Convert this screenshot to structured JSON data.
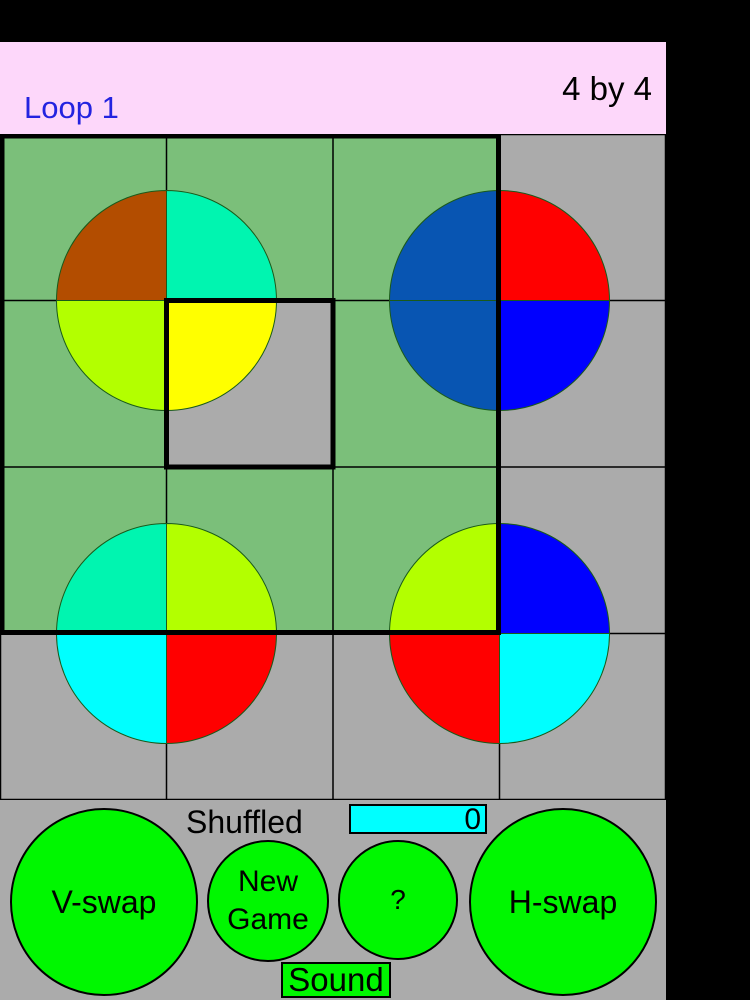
{
  "header": {
    "mode_label": "Loop 1",
    "size_label": "4 by 4"
  },
  "colors": {
    "header_bg": "#fdd7fa",
    "board_bg": "#ababab",
    "selection_bg": "#7bbf7a",
    "button_green": "#00f700",
    "counter_bg": "#00ffff"
  },
  "board": {
    "rows": 4,
    "cols": 4,
    "selection": {
      "rows": [
        0,
        2
      ],
      "cols": [
        0,
        2
      ],
      "label": "3x3 loop selection"
    },
    "empty_cell": {
      "row": 1,
      "col": 1
    },
    "pieces": [
      {
        "row": 0,
        "col": 0,
        "color": "#b34d00"
      },
      {
        "row": 0,
        "col": 1,
        "color": "#00f5b0"
      },
      {
        "row": 0,
        "col": 2,
        "color": "#0855b2"
      },
      {
        "row": 0,
        "col": 3,
        "color": "#ff0000"
      },
      {
        "row": 1,
        "col": 0,
        "color": "#b3ff00"
      },
      {
        "row": 1,
        "col": 1,
        "color": "#ffff00"
      },
      {
        "row": 1,
        "col": 2,
        "color": "#0855b2"
      },
      {
        "row": 1,
        "col": 3,
        "color": "#0000ff"
      },
      {
        "row": 2,
        "col": 0,
        "color": "#00f5b0"
      },
      {
        "row": 2,
        "col": 1,
        "color": "#b3ff00"
      },
      {
        "row": 2,
        "col": 2,
        "color": "#b3ff00"
      },
      {
        "row": 2,
        "col": 3,
        "color": "#0000ff"
      },
      {
        "row": 3,
        "col": 0,
        "color": "#00ffff"
      },
      {
        "row": 3,
        "col": 1,
        "color": "#ff0000"
      },
      {
        "row": 3,
        "col": 2,
        "color": "#ff0000"
      },
      {
        "row": 3,
        "col": 3,
        "color": "#00ffff"
      }
    ]
  },
  "controls": {
    "shuffled_label": "Shuffled",
    "shuffled_count": "0",
    "vswap_label": "V-swap",
    "new_game_line1": "New",
    "new_game_line2": "Game",
    "help_label": "?",
    "hswap_label": "H-swap",
    "sound_label": "Sound"
  }
}
